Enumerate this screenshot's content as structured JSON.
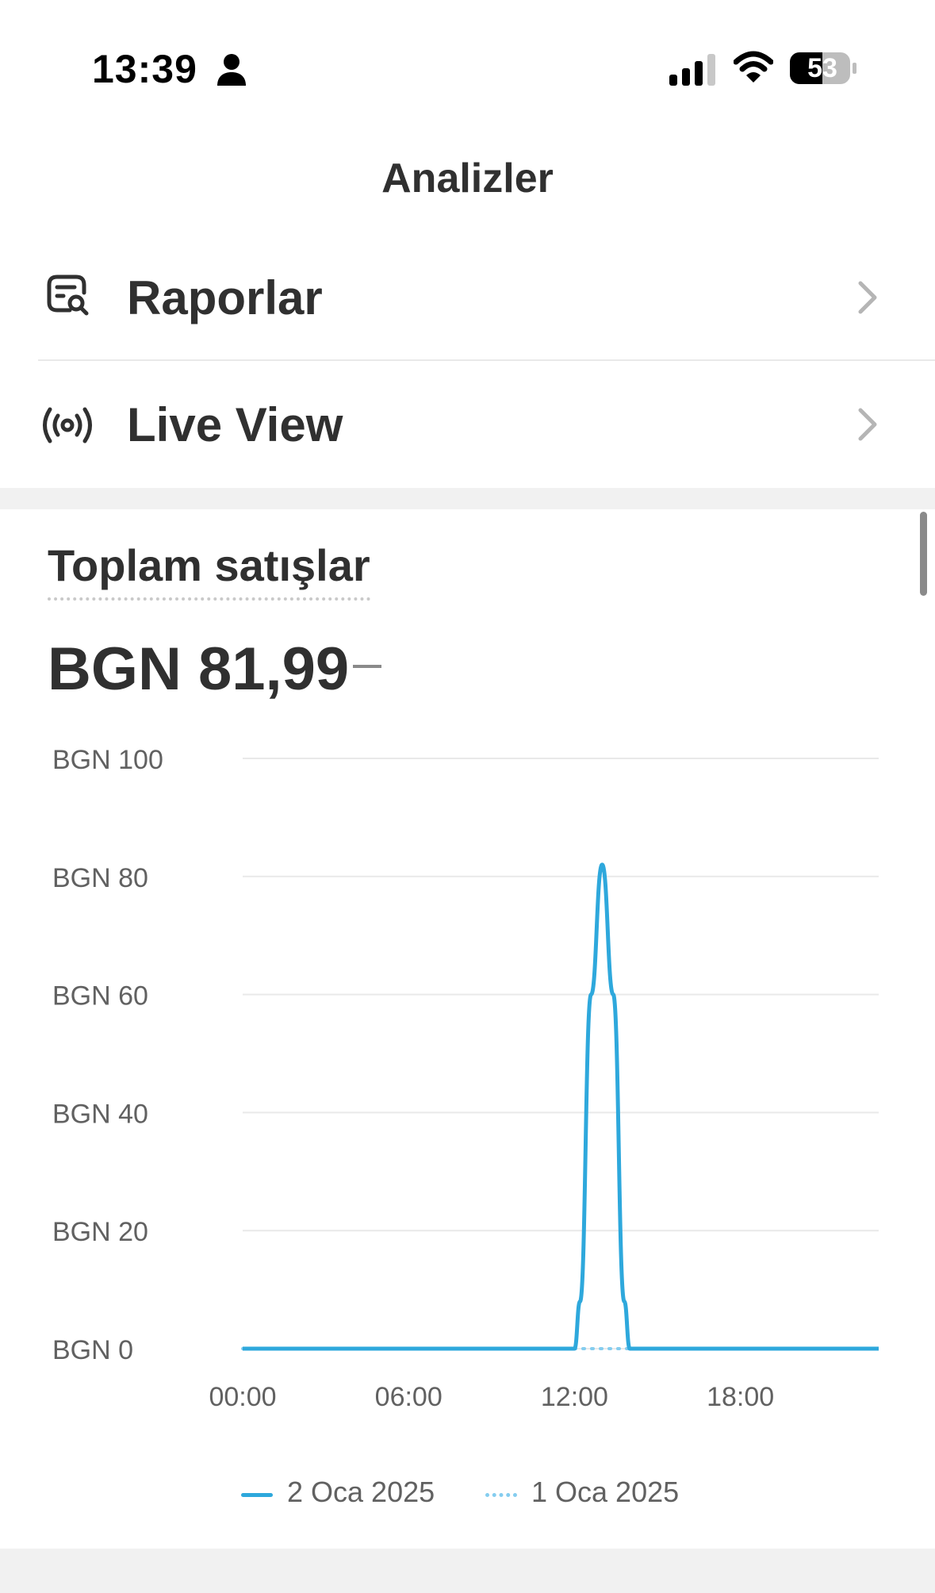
{
  "status_bar": {
    "time": "13:39",
    "battery": "53"
  },
  "header": {
    "title": "Analizler"
  },
  "menu": [
    {
      "label": "Raporlar",
      "icon": "report-search-icon"
    },
    {
      "label": "Live View",
      "icon": "live-broadcast-icon"
    }
  ],
  "card": {
    "title": "Toplam satışlar",
    "total": "BGN 81,99",
    "comparison": "–"
  },
  "colors": {
    "accent": "#2ea8dc",
    "previous": "#85cdef",
    "grid": "#e9e9e9",
    "text": "#303030",
    "muted": "#616161"
  },
  "chart_data": {
    "type": "line",
    "y_ticks": [
      "BGN 100",
      "BGN 80",
      "BGN 60",
      "BGN 40",
      "BGN 20",
      "BGN 0"
    ],
    "ylim": [
      0,
      100
    ],
    "x_ticks": [
      "00:00",
      "06:00",
      "12:00",
      "18:00"
    ],
    "xlim": [
      0,
      23
    ],
    "series": [
      {
        "name": "2 Oca 2025",
        "style": "solid",
        "x": [
          0,
          12,
          12.2,
          12.6,
          13,
          13.4,
          13.8,
          14,
          23
        ],
        "y": [
          0,
          0,
          8,
          60,
          82,
          60,
          8,
          0,
          0
        ]
      },
      {
        "name": "1 Oca 2025",
        "style": "dotted",
        "x": [
          0,
          23
        ],
        "y": [
          0,
          0
        ]
      }
    ]
  }
}
